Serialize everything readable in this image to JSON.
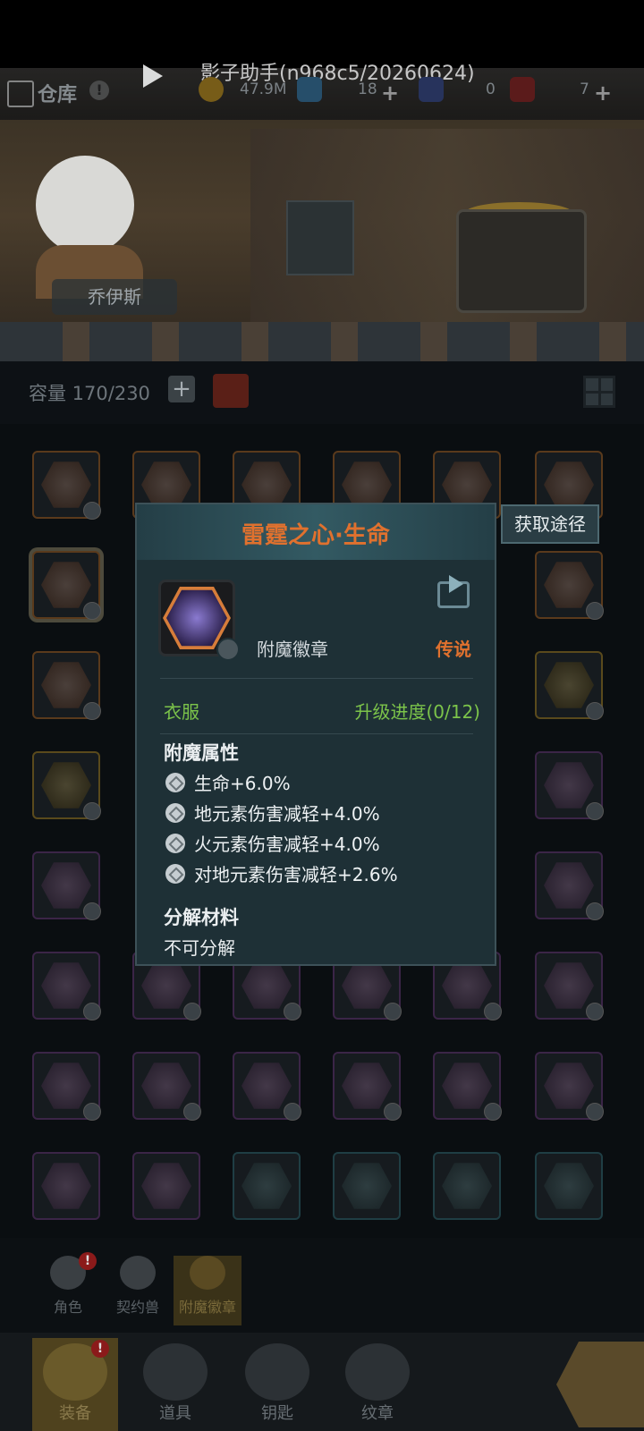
{
  "topbar": {
    "notice": "影子助手(n968c5/20260624)",
    "warehouse_label": "仓库",
    "info_icon": "!",
    "gold_value": "47.9M",
    "gem_value": "18",
    "clothes_value": "0",
    "chest_value": "7",
    "plus": "+"
  },
  "hero": {
    "name": "乔伊斯"
  },
  "capacity": {
    "text": "容量 170/230",
    "plus": "+"
  },
  "popup": {
    "title": "雷霆之心·生命",
    "item_type": "附魔徽章",
    "rarity": "传说",
    "slot": "衣服",
    "upgrade": "升级进度(0/12)",
    "attr_title": "附魔属性",
    "attributes": [
      "生命+6.0%",
      "地元素伤害减轻+4.0%",
      "火元素伤害减轻+4.0%",
      "对地元素伤害减轻+2.6%"
    ],
    "material_title": "分解材料",
    "material_value": "不可分解"
  },
  "acquire_button": "获取途径",
  "subtabs": [
    {
      "label": "角色",
      "badge": "!"
    },
    {
      "label": "契约兽"
    },
    {
      "label": "附魔徽章"
    }
  ],
  "nav": [
    {
      "label": "装备",
      "badge": "!"
    },
    {
      "label": "道具"
    },
    {
      "label": "钥匙"
    },
    {
      "label": "纹章"
    }
  ],
  "colors": {
    "legendary": "#e0712e",
    "green": "#7cc44a",
    "popup_bg": "#1e3036"
  }
}
